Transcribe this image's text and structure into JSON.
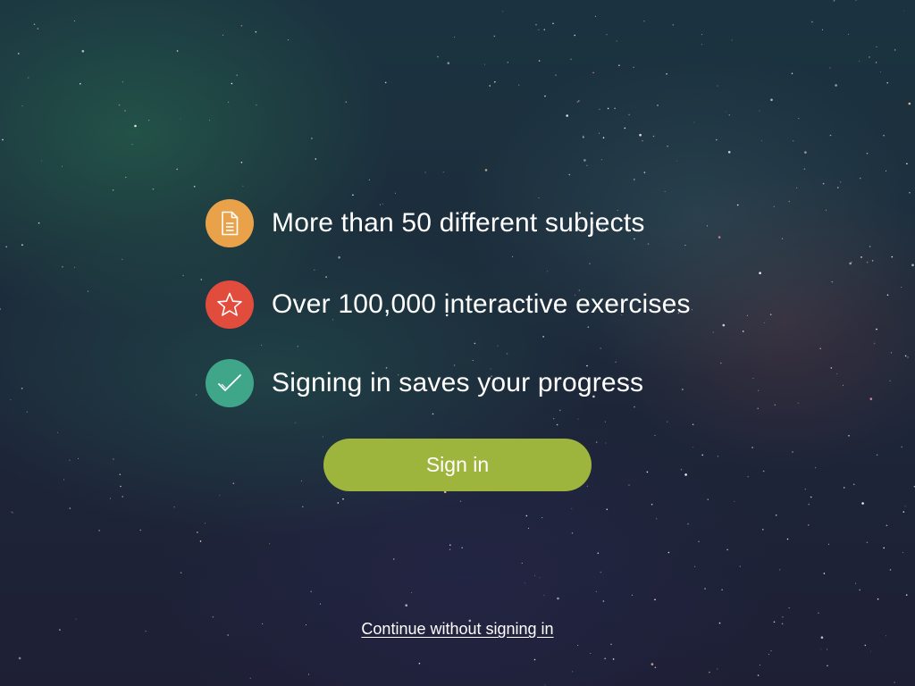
{
  "features": [
    {
      "icon": "document-icon",
      "color": "#e9a24a",
      "label": "More than 50 different subjects"
    },
    {
      "icon": "star-icon",
      "color": "#e24c3d",
      "label": "Over 100,000 interactive exercises"
    },
    {
      "icon": "checkmark-icon",
      "color": "#3fa68a",
      "label": "Signing in saves your progress"
    }
  ],
  "sign_in": {
    "label": "Sign in",
    "color": "#9db53c"
  },
  "continue_link": {
    "label": "Continue without signing in"
  }
}
